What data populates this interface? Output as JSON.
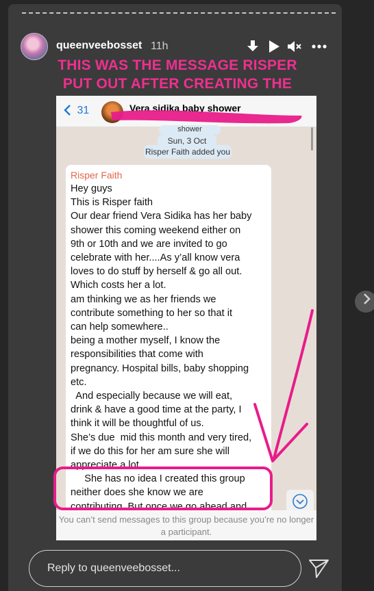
{
  "story": {
    "username": "queenveebosset",
    "time": "11h",
    "caption": "THIS WAS THE MESSAGE RISPER PUT OUT AFTER CREATING THE GROUP.",
    "reply_placeholder": "Reply to queenveebosset..."
  },
  "icons": {
    "download": "download-icon",
    "play": "play-icon",
    "mute": "mute-icon",
    "more": "more-icon",
    "send": "send-icon",
    "next": "chevron-right-icon",
    "back": "back-icon",
    "scroll_down": "chevron-down-icon"
  },
  "whatsapp": {
    "back_count": "31",
    "group_name": "Vera sidika baby shower",
    "partial_top": "shower",
    "date_pill": "Sun, 3 Oct",
    "system_pill": "Risper Faith  added you",
    "sender": "Risper Faith",
    "lines": [
      "Hey guys",
      "This is Risper faith",
      "Our dear friend Vera Sidika has her baby",
      "shower this coming weekend either on",
      "9th or 10th and we are invited to go",
      "celebrate with her....As y’all know vera",
      "loves to do stuff by herself & go all out.",
      "Which costs her a lot.",
      "am thinking we as her friends we",
      "contribute something to her so that it",
      "can help somewhere..",
      "being a mother myself, I know the",
      "responsibilities that come with",
      "pregnancy. Hospital bills, baby shopping",
      "etc.",
      "  And especially because we will eat,",
      "drink & have a good time at the party, I",
      "think it will be thoughtful of us.",
      "She’s due  mid this month and very tired,",
      "if we do this for her am sure she will",
      "appreciate a lot.",
      "     She has no idea I created this group",
      "neither does she know we are",
      "contributing. But once we go ahead and"
    ],
    "footer": "You can’t send messages to this group because you’re no longer a participant."
  },
  "colors": {
    "accent_pink": "#ef2f8f",
    "story_bg": "#3b3b3b",
    "page_bg": "#262626",
    "wa_blue": "#1e78d6",
    "sender_color": "#e2674a"
  }
}
